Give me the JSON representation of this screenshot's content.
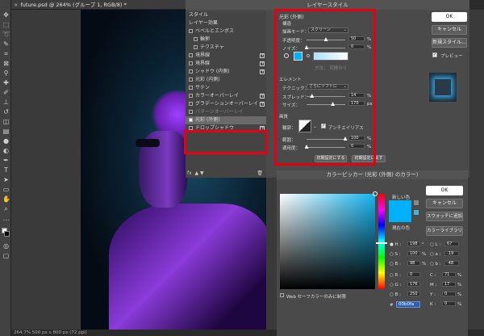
{
  "document": {
    "tab_title": "future.psd @ 264% (グループ 1, RGB/8) *",
    "status": "264.7%    500 px x 800 px (72 ppi)"
  },
  "layer_style": {
    "title": "レイヤースタイル",
    "left_panel": {
      "head1": "スタイル",
      "head2": "レイヤー効果",
      "items": [
        {
          "label": "ベベルとエンボス"
        },
        {
          "label": "輪郭"
        },
        {
          "label": "テクスチャ"
        },
        {
          "label": "境界線"
        },
        {
          "label": "境界線"
        },
        {
          "label": "シャドウ (内側)"
        },
        {
          "label": "光彩 (内側)"
        },
        {
          "label": "サテン"
        },
        {
          "label": "カラーオーバーレイ"
        },
        {
          "label": "グラデーションオーバーレイ"
        },
        {
          "label": "パターンオーバーレイ"
        },
        {
          "label": "光彩 (外側)"
        },
        {
          "label": "ドロップシャドウ"
        }
      ],
      "fx": "fx"
    },
    "outer_glow": {
      "title": "光彩 (外側)",
      "structure": "構造",
      "blend_label": "描画モード：",
      "blend_value": "スクリーン",
      "opacity_label": "不透明度：",
      "opacity_value": "50",
      "opacity_level": 0.5,
      "noise_label": "ノイズ：",
      "noise_value": "0",
      "noise_level": 0.0,
      "pct": "%",
      "method_hint": "方法：   究極のリ",
      "elements": "エレメント",
      "technique_label": "テクニック：",
      "technique_value": "さらにソフトに",
      "spread_label": "スプレッド：",
      "spread_value": "14",
      "spread_level": 0.14,
      "size_label": "サイズ：",
      "size_value": "170",
      "size_level": 0.68,
      "px": "px",
      "quality": "画質",
      "contour_label": "輪郭：",
      "antialias_label": "アンチエイリアス",
      "range_label": "範囲：",
      "range_value": "100",
      "range_level": 1.0,
      "jitter_label": "適用度：",
      "jitter_value": "0",
      "jitter_level": 0.0,
      "glow_color": "#00b0fa",
      "btn_default": "初期設定にする",
      "btn_reset": "初期設定に戻す"
    },
    "buttons": {
      "ok": "OK",
      "cancel": "キャンセル",
      "new_style": "新規スタイル...",
      "preview": "プレビュー"
    }
  },
  "color_picker": {
    "title": "カラーピッカー (光彩 (外側) のカラー)",
    "new_label": "新しい色",
    "current_label": "現在の色",
    "buttons": {
      "ok": "OK",
      "cancel": "キャンセル",
      "swatch": "スウォッチに追加",
      "library": "カラーライブラリ"
    },
    "web_safe": "Web セーフカラーのみに制限",
    "values": {
      "H": "198",
      "H_unit": "°",
      "S": "100",
      "S_unit": "%",
      "B": "98",
      "B_unit": "%",
      "R": "0",
      "G": "176",
      "Bl": "250",
      "L": "67",
      "a": "-19",
      "b": "-48",
      "C": "71",
      "C_unit": "%",
      "M": "17",
      "M_unit": "%",
      "Y": "0",
      "Y_unit": "%",
      "K": "0",
      "K_unit": "%",
      "hex": "00b0fa"
    },
    "new_color": "#00b0fa"
  },
  "highlight_color": "#e60012"
}
